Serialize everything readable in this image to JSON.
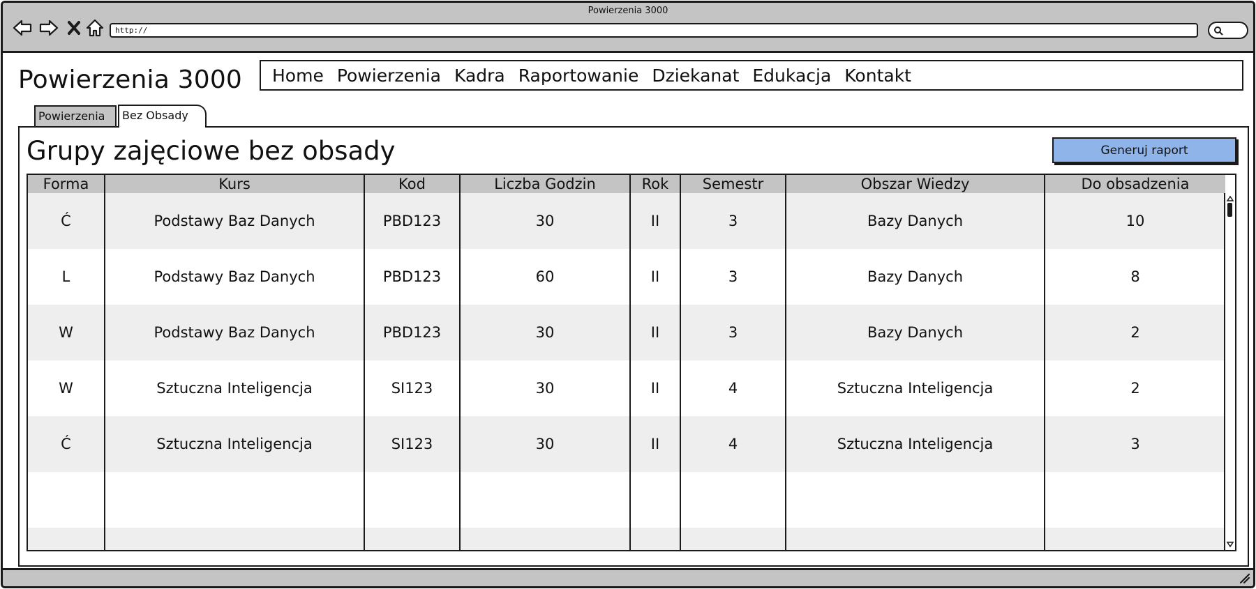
{
  "window": {
    "title": "Powierzenia 3000",
    "url": "http://"
  },
  "icons": {
    "back": "arrow-left-icon",
    "forward": "arrow-right-icon",
    "stop": "close-icon",
    "home": "home-icon",
    "search": "search-icon",
    "resize": "resize-grip-icon"
  },
  "app": {
    "title": "Powierzenia 3000"
  },
  "menu": {
    "items": [
      "Home",
      "Powierzenia",
      "Kadra",
      "Raportowanie",
      "Dziekanat",
      "Edukacja",
      "Kontakt"
    ]
  },
  "tabs": [
    {
      "label": "Powierzenia",
      "active": false
    },
    {
      "label": "Bez Obsady",
      "active": true
    }
  ],
  "main": {
    "title": "Grupy zajęciowe bez obsady",
    "report_button": "Generuj raport"
  },
  "table": {
    "columns": [
      "Forma",
      "Kurs",
      "Kod",
      "Liczba Godzin",
      "Rok",
      "Semestr",
      "Obszar Wiedzy",
      "Do obsadzenia"
    ],
    "rows": [
      [
        "Ć",
        "Podstawy Baz Danych",
        "PBD123",
        "30",
        "II",
        "3",
        "Bazy Danych",
        "10"
      ],
      [
        "L",
        "Podstawy Baz Danych",
        "PBD123",
        "60",
        "II",
        "3",
        "Bazy Danych",
        "8"
      ],
      [
        "W",
        "Podstawy Baz Danych",
        "PBD123",
        "30",
        "II",
        "3",
        "Bazy Danych",
        "2"
      ],
      [
        "W",
        "Sztuczna Inteligencja",
        "SI123",
        "30",
        "II",
        "4",
        "Sztuczna Inteligencja",
        "2"
      ],
      [
        "Ć",
        "Sztuczna Inteligencja",
        "SI123",
        "30",
        "II",
        "4",
        "Sztuczna Inteligencja",
        "3"
      ],
      [
        "",
        "",
        "",
        "",
        "",
        "",
        "",
        ""
      ],
      [
        "",
        "",
        "",
        "",
        "",
        "",
        "",
        ""
      ]
    ]
  },
  "colors": {
    "chrome": "#c4c4c4",
    "button_accent": "#8fb4ea",
    "row_alt": "#eeeeee",
    "border": "#1a1a1a"
  }
}
